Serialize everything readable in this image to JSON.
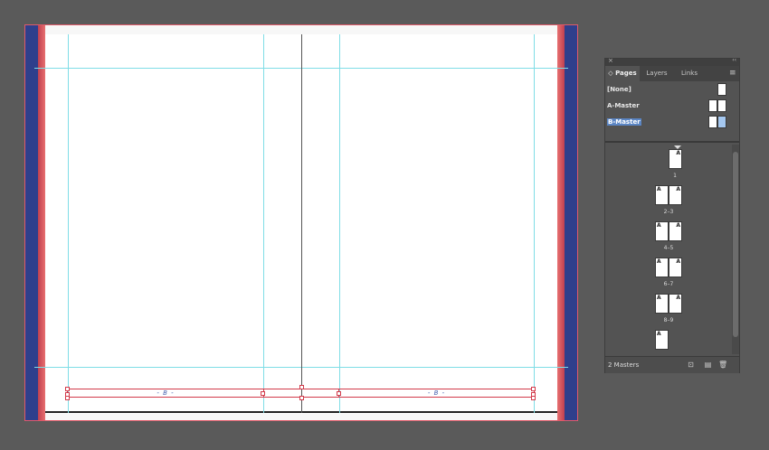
{
  "document": {
    "footer_left": "- B -",
    "footer_right": "- B -"
  },
  "panel": {
    "close_glyph": "×",
    "collapse_glyph": "‹‹",
    "tabs": [
      {
        "label": "◇ Pages",
        "active": true
      },
      {
        "label": "Layers",
        "active": false
      },
      {
        "label": "Links",
        "active": false
      }
    ],
    "menu_glyph": "≡",
    "masters": [
      {
        "label": "[None]"
      },
      {
        "label": "A-Master"
      },
      {
        "label": "B-Master",
        "selected": true
      }
    ],
    "pages": [
      {
        "label": "1",
        "prefix_left": "",
        "prefix_right": "A"
      },
      {
        "label": "2–3",
        "prefix_left": "A",
        "prefix_right": "A"
      },
      {
        "label": "4–5",
        "prefix_left": "A",
        "prefix_right": "A"
      },
      {
        "label": "6–7",
        "prefix_left": "A",
        "prefix_right": "A"
      },
      {
        "label": "8–9",
        "prefix_left": "A",
        "prefix_right": "A"
      },
      {
        "label": "",
        "prefix_left": "A",
        "prefix_right": ""
      }
    ],
    "status": "2 Masters",
    "icons": [
      "page-size-icon",
      "new-page-icon",
      "delete-page-icon"
    ],
    "icon_glyphs": [
      "⊡",
      "▤",
      "🗑"
    ]
  },
  "colors": {
    "guide": "#7fdde6",
    "frame": "#d23a4a",
    "bleed_blue": "#2f3f8c",
    "selection": "#5b86c5"
  }
}
